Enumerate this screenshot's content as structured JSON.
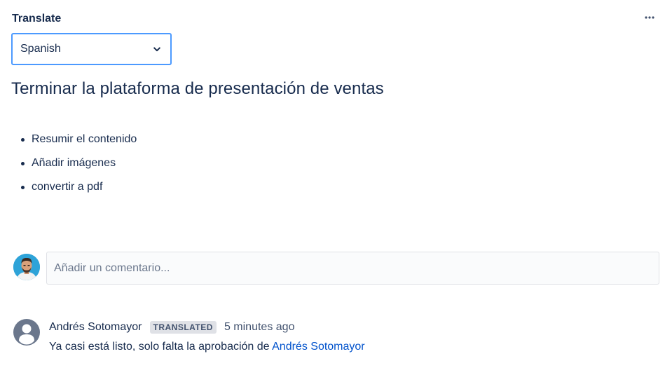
{
  "header": {
    "title": "Translate",
    "more_icon": "more-horizontal-icon"
  },
  "language_select": {
    "selected": "Spanish",
    "icon": "chevron-down-icon",
    "accent_color": "#4c9aff"
  },
  "page": {
    "heading": "Terminar la plataforma de presentación de ventas",
    "items": [
      {
        "label": "Resumir el contenido"
      },
      {
        "label": "Añadir imágenes"
      },
      {
        "label": "convertir a pdf"
      }
    ]
  },
  "comment_box": {
    "placeholder": "Añadir un comentario...",
    "value": ""
  },
  "comment": {
    "author": "Andrés Sotomayor",
    "badge": "TRANSLATED",
    "time": "5 minutes ago",
    "body_text": "Ya casi está listo, solo falta la aprobación de ",
    "mention": "Andrés Sotomayor",
    "avatar_icon": "default-user-avatar-icon"
  },
  "colors": {
    "text": "#172b4d",
    "link": "#0052cc",
    "badge_bg": "#dfe1e6"
  }
}
